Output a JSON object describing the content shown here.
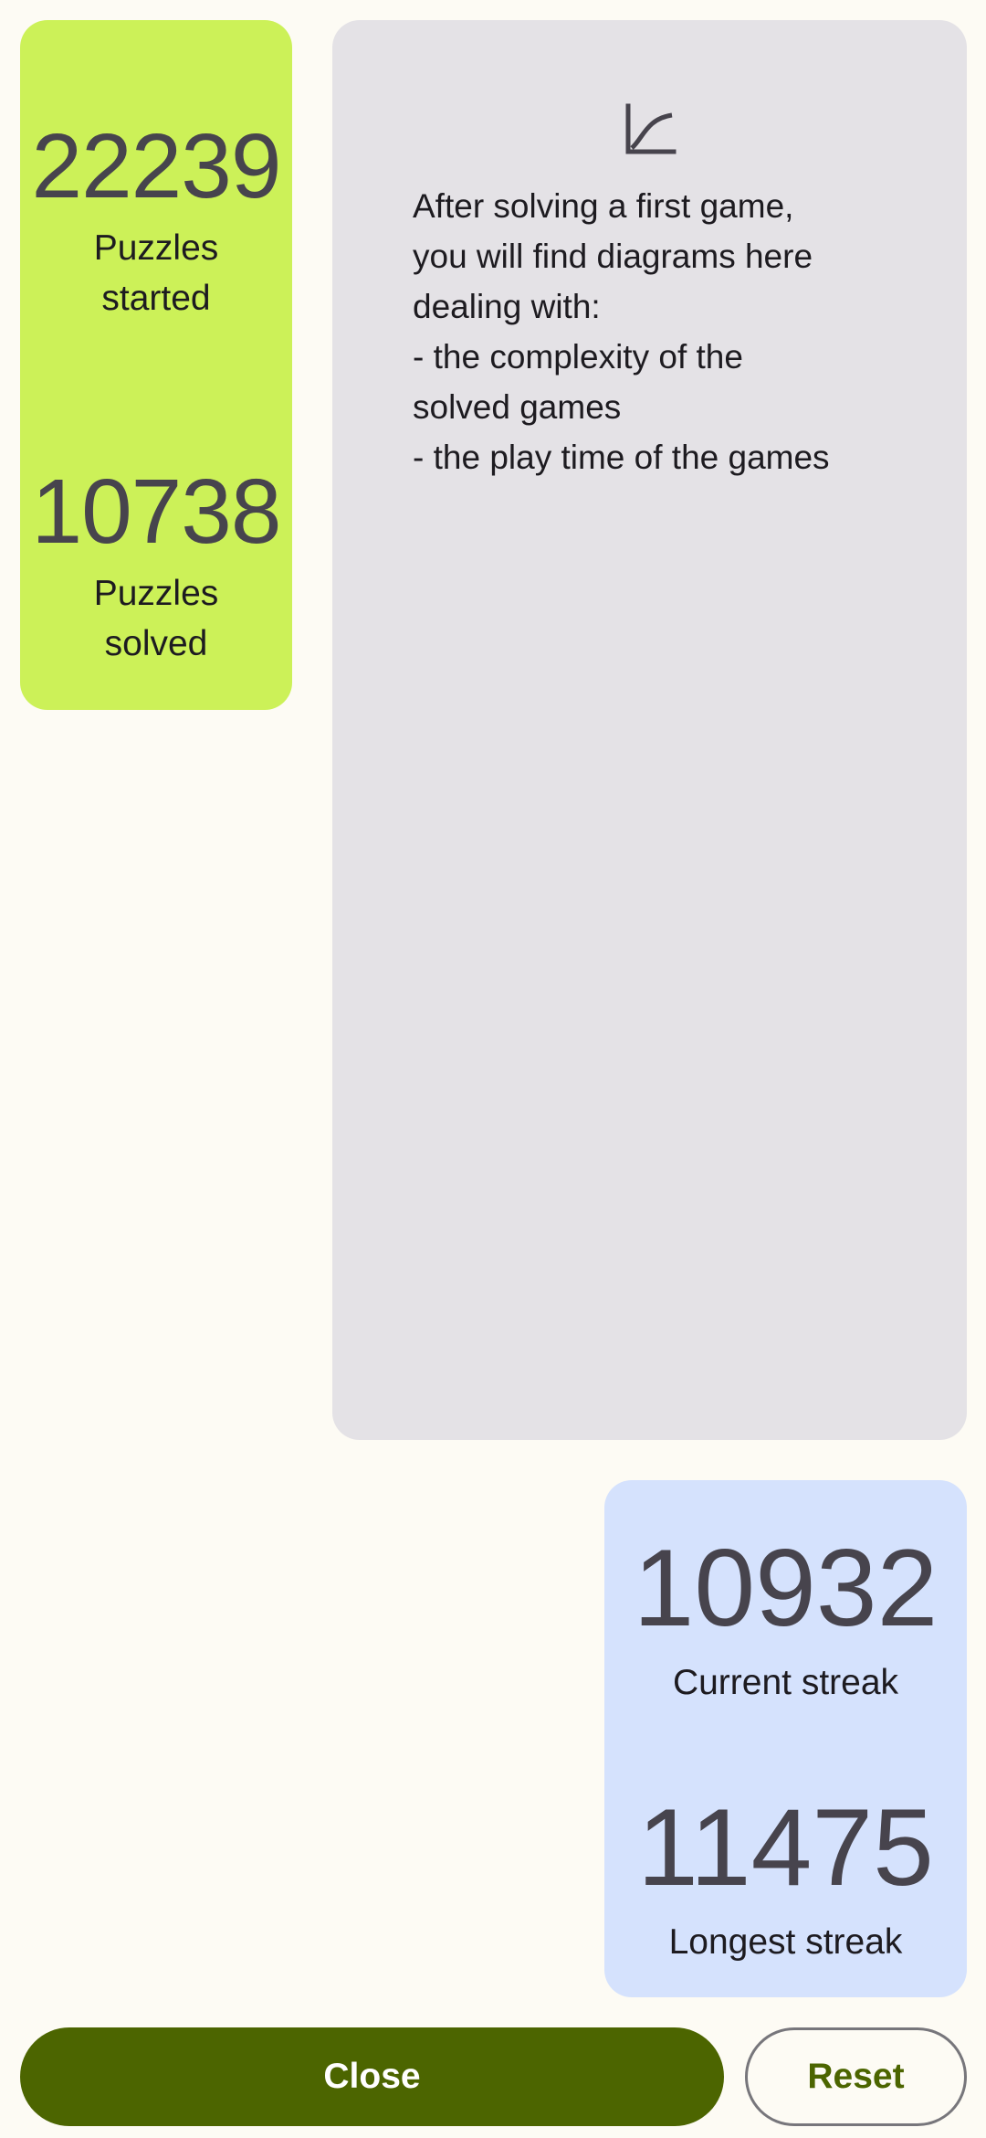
{
  "stats_left": {
    "started": {
      "value": "22239",
      "label": "Puzzles started"
    },
    "solved": {
      "value": "10738",
      "label": "Puzzles solved"
    }
  },
  "diagram_panel": {
    "icon": "chart-curve-icon",
    "lines": [
      "After solving a first game,",
      "you will find diagrams here",
      "dealing with:",
      "- the complexity of the",
      "solved games",
      "- the play time of the games"
    ]
  },
  "streaks": {
    "current": {
      "value": "10932",
      "label": "Current streak"
    },
    "longest": {
      "value": "11475",
      "label": "Longest streak"
    }
  },
  "actions": {
    "close_label": "Close",
    "reset_label": "Reset"
  },
  "colors": {
    "background": "#fdfbf4",
    "green_card": "#ccf158",
    "grey_card": "#e4e2e6",
    "blue_card": "#d5e2fd",
    "primary": "#4c6500"
  }
}
